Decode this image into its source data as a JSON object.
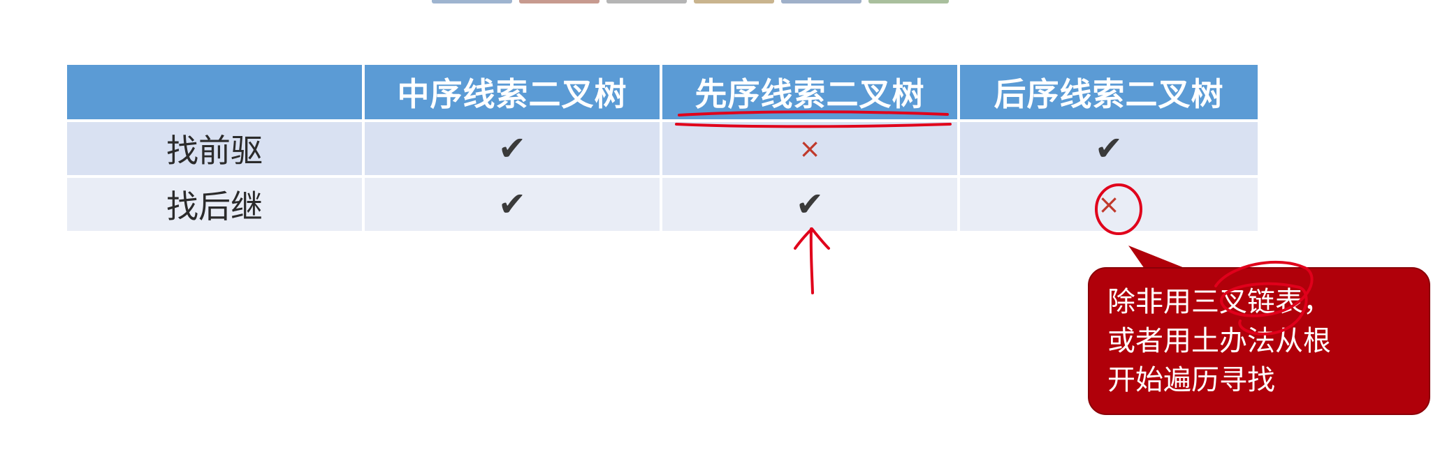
{
  "table": {
    "headers": [
      "",
      "中序线索二叉树",
      "先序线索二叉树",
      "后序线索二叉树"
    ],
    "rows": [
      {
        "label": "找前驱",
        "cells": [
          "✔",
          "×",
          "✔"
        ]
      },
      {
        "label": "找后继",
        "cells": [
          "✔",
          "✔",
          "×"
        ]
      }
    ]
  },
  "callout": {
    "lines": [
      "除非用三叉链表，",
      "或者用土办法从根",
      "开始遍历寻找"
    ]
  },
  "colors": {
    "header": "#5b9bd5",
    "row1": "#d9e1f2",
    "row2": "#e9edf6",
    "callout": "#b0000a",
    "annotation": "#e0001b"
  },
  "top_strip_colors": [
    "#9eb4cf",
    "#c79a8f",
    "#b5b5b5",
    "#c9b48e",
    "#9fb0c9",
    "#a9bf9d"
  ]
}
